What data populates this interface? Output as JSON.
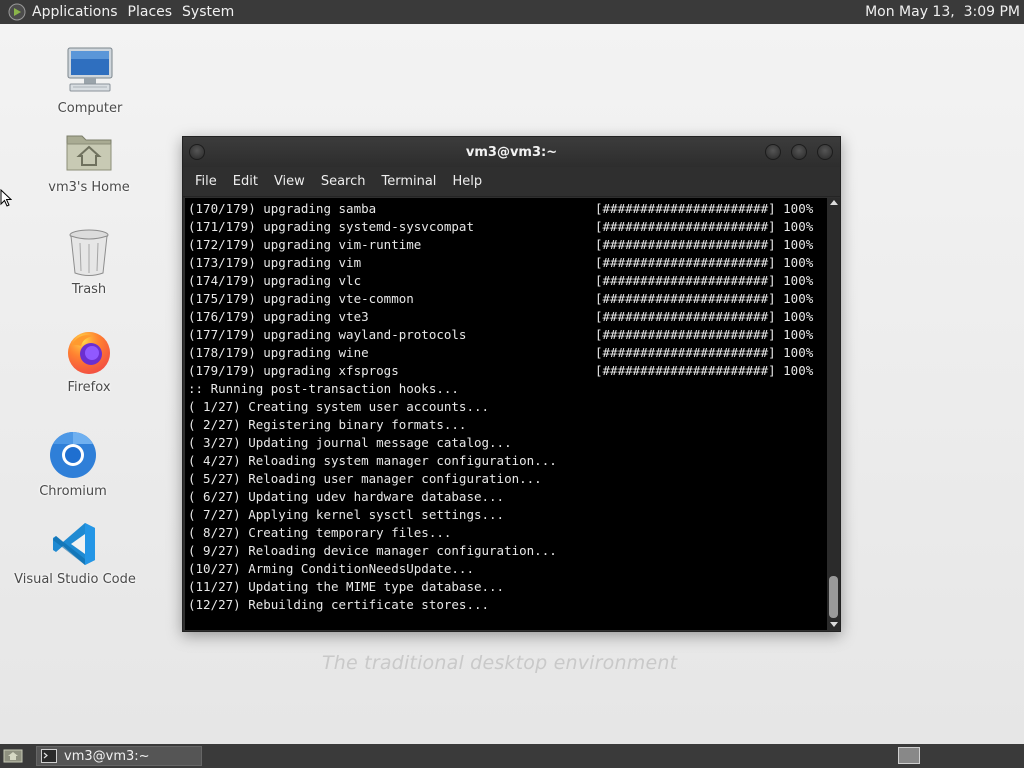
{
  "top_panel": {
    "applications": "Applications",
    "places": "Places",
    "system": "System",
    "clock": "Mon May 13,  3:09 PM"
  },
  "desktop": {
    "wallpaper_text": "The traditional desktop environment",
    "icons": [
      {
        "label": "Computer",
        "icon": "computer-icon"
      },
      {
        "label": "vm3's Home",
        "icon": "home-folder-icon"
      },
      {
        "label": "Trash",
        "icon": "trash-icon"
      },
      {
        "label": "Firefox",
        "icon": "firefox-icon"
      },
      {
        "label": "Chromium",
        "icon": "chromium-icon"
      },
      {
        "label": "Visual Studio Code",
        "icon": "vscode-icon"
      }
    ]
  },
  "terminal": {
    "title": "vm3@vm3:~",
    "menu": [
      "File",
      "Edit",
      "View",
      "Search",
      "Terminal",
      "Help"
    ],
    "lines": [
      {
        "text": "(170/179) upgrading samba",
        "bar": "[######################] 100%"
      },
      {
        "text": "(171/179) upgrading systemd-sysvcompat",
        "bar": "[######################] 100%"
      },
      {
        "text": "(172/179) upgrading vim-runtime",
        "bar": "[######################] 100%"
      },
      {
        "text": "(173/179) upgrading vim",
        "bar": "[######################] 100%"
      },
      {
        "text": "(174/179) upgrading vlc",
        "bar": "[######################] 100%"
      },
      {
        "text": "(175/179) upgrading vte-common",
        "bar": "[######################] 100%"
      },
      {
        "text": "(176/179) upgrading vte3",
        "bar": "[######################] 100%"
      },
      {
        "text": "(177/179) upgrading wayland-protocols",
        "bar": "[######################] 100%"
      },
      {
        "text": "(178/179) upgrading wine",
        "bar": "[######################] 100%"
      },
      {
        "text": "(179/179) upgrading xfsprogs",
        "bar": "[######################] 100%"
      },
      {
        "text": ":: Running post-transaction hooks...",
        "bar": ""
      },
      {
        "text": "( 1/27) Creating system user accounts...",
        "bar": ""
      },
      {
        "text": "( 2/27) Registering binary formats...",
        "bar": ""
      },
      {
        "text": "( 3/27) Updating journal message catalog...",
        "bar": ""
      },
      {
        "text": "( 4/27) Reloading system manager configuration...",
        "bar": ""
      },
      {
        "text": "( 5/27) Reloading user manager configuration...",
        "bar": ""
      },
      {
        "text": "( 6/27) Updating udev hardware database...",
        "bar": ""
      },
      {
        "text": "( 7/27) Applying kernel sysctl settings...",
        "bar": ""
      },
      {
        "text": "( 8/27) Creating temporary files...",
        "bar": ""
      },
      {
        "text": "( 9/27) Reloading device manager configuration...",
        "bar": ""
      },
      {
        "text": "(10/27) Arming ConditionNeedsUpdate...",
        "bar": ""
      },
      {
        "text": "(11/27) Updating the MIME type database...",
        "bar": ""
      },
      {
        "text": "(12/27) Rebuilding certificate stores...",
        "bar": ""
      }
    ]
  },
  "bottom_panel": {
    "taskbar_item": "vm3@vm3:~"
  }
}
